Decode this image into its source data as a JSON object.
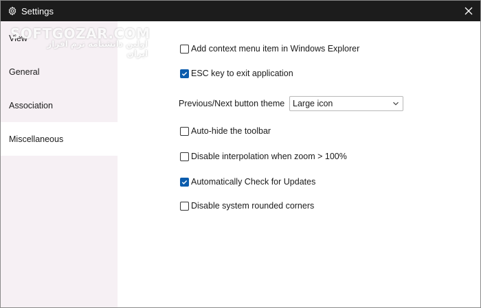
{
  "window": {
    "title": "Settings",
    "title_icon": "gear-icon",
    "close_icon": "close-icon"
  },
  "sidebar": {
    "items": [
      {
        "label": "View",
        "active": false
      },
      {
        "label": "General",
        "active": false
      },
      {
        "label": "Association",
        "active": false
      },
      {
        "label": "Miscellaneous",
        "active": true
      }
    ]
  },
  "watermark": {
    "line1": "SOFTGOZAR.COM",
    "line2": "اولین دانشنامه نرم افزار ایران"
  },
  "settings": {
    "context_menu": {
      "label": "Add context menu item in Windows Explorer",
      "checked": false
    },
    "esc_exit": {
      "label": "ESC key to exit application",
      "checked": true
    },
    "button_theme": {
      "label": "Previous/Next button theme",
      "value": "Large icon"
    },
    "auto_hide": {
      "label": "Auto-hide the toolbar",
      "checked": false
    },
    "disable_interpolation": {
      "label": "Disable interpolation when zoom > 100%",
      "checked": false
    },
    "auto_update": {
      "label": "Automatically Check for Updates",
      "checked": true
    },
    "rounded_corners": {
      "label": "Disable system rounded corners",
      "checked": false
    }
  },
  "colors": {
    "titlebar": "#1c1c1c",
    "sidebar": "#f6f0f4",
    "accent": "#0b5cad"
  }
}
